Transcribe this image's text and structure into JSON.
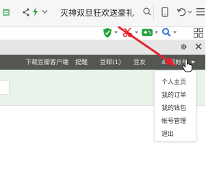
{
  "browser": {
    "search_text": "灭神双旦狂欢送豪礼",
    "icons": [
      "page-icon",
      "share-icon",
      "lightning-icon",
      "chevron-down-icon",
      "search-icon",
      "phone-icon",
      "undo-icon",
      "menu-icon"
    ]
  },
  "toolbar": {
    "extensions": [
      "shield-icon",
      "scissors-icon",
      "gamepad-icon",
      "search-ext-icon",
      "apps-grid-icon"
    ],
    "page_controls": [
      "settings-icon",
      "close-icon"
    ]
  },
  "nav": {
    "items": [
      "下载豆瓣客户端",
      "提醒",
      "豆邮(1)",
      "豆友",
      "42的帐号"
    ]
  },
  "account_menu": {
    "items": [
      "个人主页",
      "我的订单",
      "我的钱包",
      "帐号管理",
      "退出"
    ]
  },
  "colors": {
    "nav_bg": "#545652",
    "green_band": "#e8f4e9",
    "arrow": "#e8202a",
    "accent_green": "#2aa33e"
  }
}
